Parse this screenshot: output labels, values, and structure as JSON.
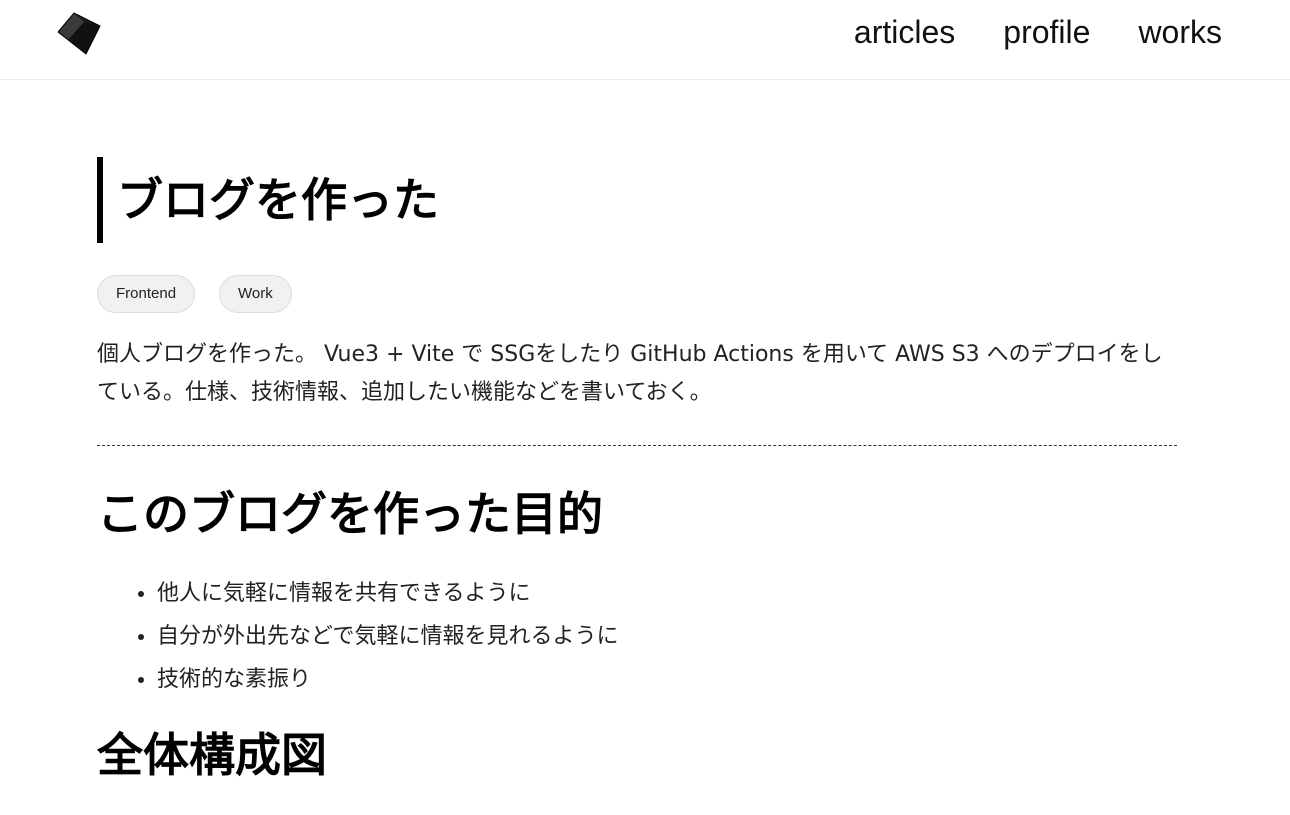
{
  "header": {
    "logo_icon": "diamond-cube-logo-icon",
    "nav": [
      {
        "label": "articles"
      },
      {
        "label": "profile"
      },
      {
        "label": "works"
      }
    ]
  },
  "article": {
    "title": "ブログを作った",
    "tags": [
      "Frontend",
      "Work"
    ],
    "intro": "個人ブログを作った。 Vue3 + Vite で SSGをしたり GitHub Actions を用いて AWS S3 へのデプロイをしている。仕様、技術情報、追加したい機能などを書いておく。",
    "section1": {
      "heading": "このブログを作った目的",
      "items": [
        "他人に気軽に情報を共有できるように",
        "自分が外出先などで気軽に情報を見れるように",
        "技術的な素振り"
      ]
    },
    "section2": {
      "heading": "全体構成図"
    }
  },
  "colors": {
    "text": "#000000",
    "tag_bg": "#f1f1f1",
    "tag_border": "#dcdcdc",
    "divider": "#333333"
  }
}
